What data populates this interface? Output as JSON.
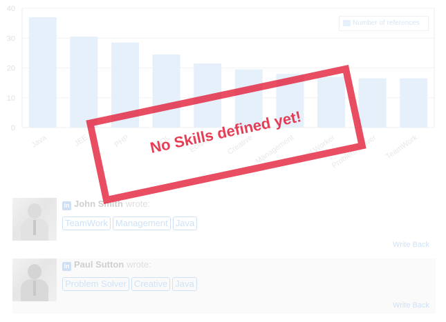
{
  "chart_data": {
    "type": "bar",
    "categories": [
      "Java",
      "JEE",
      "PHP",
      "SQL",
      "Eclipse",
      "Creative",
      "Management",
      "Hard Worker",
      "Problem Solver",
      "TeamWork"
    ],
    "series": [
      {
        "name": "Number of references",
        "values": [
          37,
          30.5,
          28.5,
          24.5,
          21.5,
          19.5,
          18,
          17,
          16.5,
          16.5
        ]
      }
    ],
    "ylim": [
      0,
      40
    ],
    "yticks": [
      0,
      10,
      20,
      30,
      40
    ],
    "grid": true,
    "legend_position": "top-right",
    "colors": {
      "bar": "#e6f0fb",
      "grid": "#f2f2f2",
      "axis": "#eeeeee"
    }
  },
  "stamp": {
    "text": "No Skills defined yet!",
    "color": "#e21b36"
  },
  "reviews": [
    {
      "author": "John Smith",
      "wrote": "wrote:",
      "source_icon": "linkedin-icon",
      "tags": [
        "TeamWork",
        "Management",
        "Java"
      ],
      "write_back": "Write Back"
    },
    {
      "author": "Paul Sutton",
      "wrote": "wrote:",
      "source_icon": "linkedin-icon",
      "tags": [
        "Problem Solver",
        "Creative",
        "Java"
      ],
      "write_back": "Write Back"
    }
  ]
}
